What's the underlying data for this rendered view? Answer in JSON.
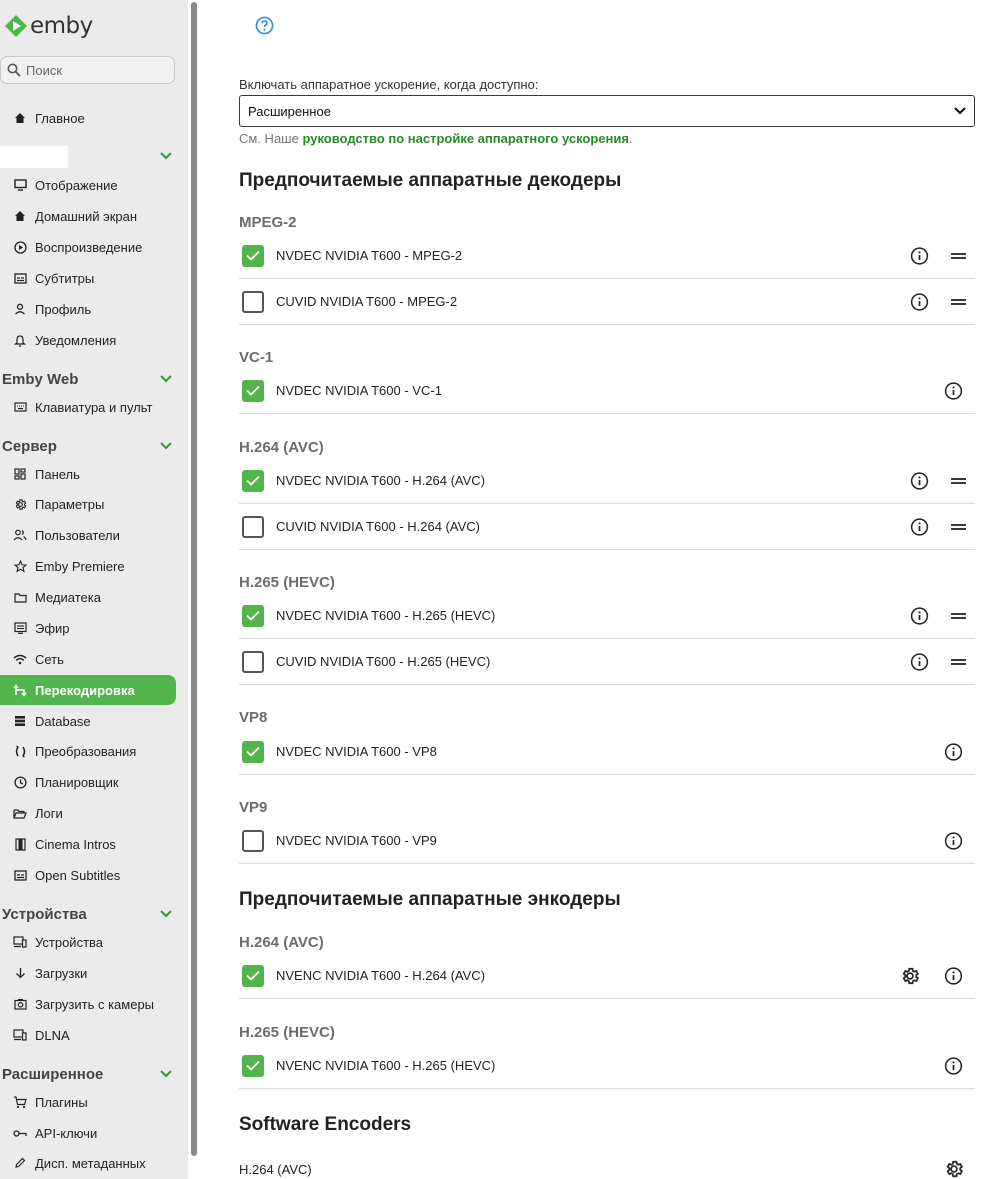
{
  "app": {
    "logo_text": "emby"
  },
  "search": {
    "placeholder": "Поиск"
  },
  "nav": {
    "home": "Главное",
    "user_items": [
      "Отображение",
      "Домашний экран",
      "Воспроизведение",
      "Субтитры",
      "Профиль",
      "Уведомления"
    ],
    "emby_web": {
      "title": "Emby Web",
      "items": [
        "Клавиатура и пульт"
      ]
    },
    "server": {
      "title": "Сервер",
      "items": [
        "Панель",
        "Параметры",
        "Пользователи",
        "Emby Premiere",
        "Медиатека",
        "Эфир",
        "Сеть",
        "Перекодировка",
        "Database",
        "Преобразования",
        "Планировщик",
        "Логи",
        "Cinema Intros",
        "Open Subtitles"
      ],
      "active": "Перекодировка"
    },
    "devices": {
      "title": "Устройства",
      "items": [
        "Устройства",
        "Загрузки",
        "Загрузить с камеры",
        "DLNA"
      ]
    },
    "advanced": {
      "title": "Расширенное",
      "items": [
        "Плагины",
        "API-ключи",
        "Дисп. метаданных"
      ]
    }
  },
  "hw_accel": {
    "label": "Включать аппаратное ускорение, когда доступно:",
    "value": "Расширенное",
    "hint_prefix": "См. Наше ",
    "hint_link": "руководство по настройке аппаратного ускорения",
    "hint_suffix": "."
  },
  "decoders": {
    "title": "Предпочитаемые аппаратные декодеры",
    "groups": [
      {
        "codec": "MPEG-2",
        "rows": [
          {
            "label": "NVDEC NVIDIA T600 - MPEG-2",
            "checked": true
          },
          {
            "label": "CUVID NVIDIA T600 - MPEG-2",
            "checked": false
          }
        ]
      },
      {
        "codec": "VC-1",
        "rows": [
          {
            "label": "NVDEC NVIDIA T600 - VC-1",
            "checked": true
          }
        ]
      },
      {
        "codec": "H.264 (AVC)",
        "rows": [
          {
            "label": "NVDEC NVIDIA T600 - H.264 (AVC)",
            "checked": true
          },
          {
            "label": "CUVID NVIDIA T600 - H.264 (AVC)",
            "checked": false
          }
        ]
      },
      {
        "codec": "H.265 (HEVC)",
        "rows": [
          {
            "label": "NVDEC NVIDIA T600 - H.265 (HEVC)",
            "checked": true
          },
          {
            "label": "CUVID NVIDIA T600 - H.265 (HEVC)",
            "checked": false
          }
        ]
      },
      {
        "codec": "VP8",
        "rows": [
          {
            "label": "NVDEC NVIDIA T600 - VP8",
            "checked": true
          }
        ]
      },
      {
        "codec": "VP9",
        "rows": [
          {
            "label": "NVDEC NVIDIA T600 - VP9",
            "checked": false
          }
        ]
      }
    ]
  },
  "encoders": {
    "title": "Предпочитаемые аппаратные энкодеры",
    "groups": [
      {
        "codec": "H.264 (AVC)",
        "rows": [
          {
            "label": "NVENC NVIDIA T600 - H.264 (AVC)",
            "checked": true
          }
        ]
      },
      {
        "codec": "H.265 (HEVC)",
        "rows": [
          {
            "label": "NVENC NVIDIA T600 - H.265 (HEVC)",
            "checked": true
          }
        ]
      }
    ]
  },
  "software_encoders": {
    "title": "Software Encoders",
    "rows": [
      {
        "label": "H.264 (AVC)"
      }
    ]
  },
  "colors": {
    "accent": "#52b54b",
    "link": "#2a8a2a",
    "help": "#2c8fe0"
  }
}
